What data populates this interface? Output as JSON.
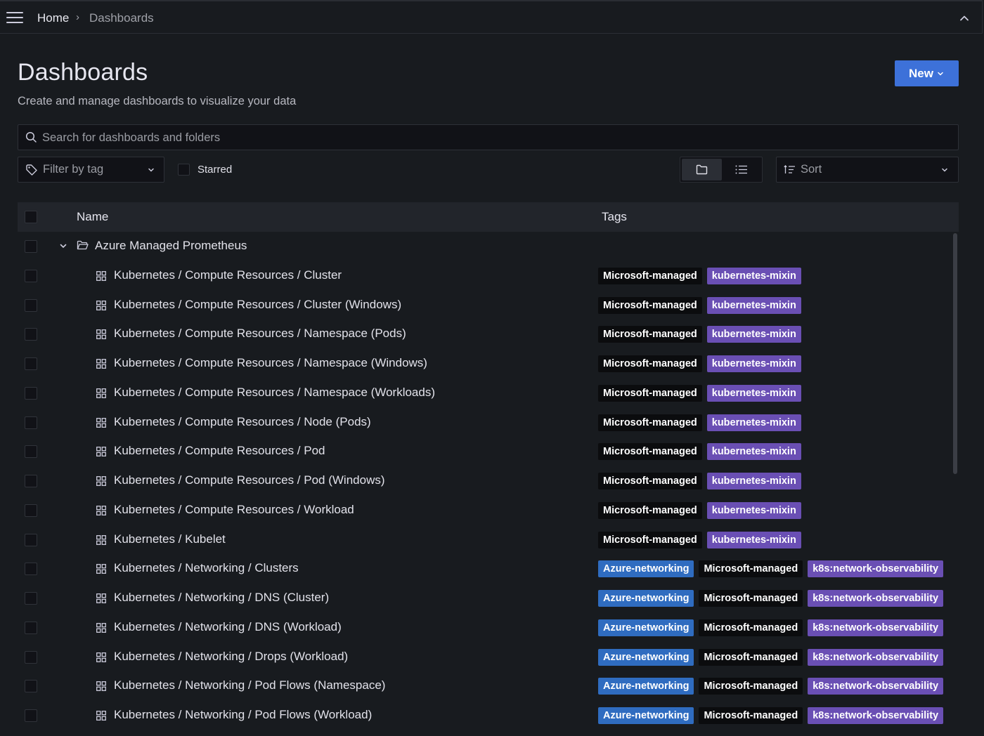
{
  "breadcrumb": {
    "home": "Home",
    "separator": "›",
    "current": "Dashboards"
  },
  "page": {
    "title": "Dashboards",
    "subtitle": "Create and manage dashboards to visualize your data",
    "new_button": "New"
  },
  "search": {
    "placeholder": "Search for dashboards and folders"
  },
  "filters": {
    "tag_placeholder": "Filter by tag",
    "starred_label": "Starred",
    "sort_placeholder": "Sort"
  },
  "table": {
    "headers": {
      "name": "Name",
      "tags": "Tags"
    }
  },
  "colors": {
    "microsoft_managed": "#0b0c0e",
    "kubernetes_mixin": "#6a4fb4",
    "azure_networking": "#2f6cc0",
    "k8s_observability": "#6a4fb4"
  },
  "folder": {
    "name": "Azure Managed Prometheus"
  },
  "dashboards": [
    {
      "name": "Kubernetes / Compute Resources / Cluster",
      "tags": [
        "Microsoft-managed",
        "kubernetes-mixin"
      ]
    },
    {
      "name": "Kubernetes / Compute Resources / Cluster (Windows)",
      "tags": [
        "Microsoft-managed",
        "kubernetes-mixin"
      ]
    },
    {
      "name": "Kubernetes / Compute Resources / Namespace (Pods)",
      "tags": [
        "Microsoft-managed",
        "kubernetes-mixin"
      ]
    },
    {
      "name": "Kubernetes / Compute Resources / Namespace (Windows)",
      "tags": [
        "Microsoft-managed",
        "kubernetes-mixin"
      ]
    },
    {
      "name": "Kubernetes / Compute Resources / Namespace (Workloads)",
      "tags": [
        "Microsoft-managed",
        "kubernetes-mixin"
      ]
    },
    {
      "name": "Kubernetes / Compute Resources / Node (Pods)",
      "tags": [
        "Microsoft-managed",
        "kubernetes-mixin"
      ]
    },
    {
      "name": "Kubernetes / Compute Resources / Pod",
      "tags": [
        "Microsoft-managed",
        "kubernetes-mixin"
      ]
    },
    {
      "name": "Kubernetes / Compute Resources / Pod (Windows)",
      "tags": [
        "Microsoft-managed",
        "kubernetes-mixin"
      ]
    },
    {
      "name": "Kubernetes / Compute Resources / Workload",
      "tags": [
        "Microsoft-managed",
        "kubernetes-mixin"
      ]
    },
    {
      "name": "Kubernetes / Kubelet",
      "tags": [
        "Microsoft-managed",
        "kubernetes-mixin"
      ]
    },
    {
      "name": "Kubernetes / Networking / Clusters",
      "tags": [
        "Azure-networking",
        "Microsoft-managed",
        "k8s:network-observability"
      ]
    },
    {
      "name": "Kubernetes / Networking / DNS (Cluster)",
      "tags": [
        "Azure-networking",
        "Microsoft-managed",
        "k8s:network-observability"
      ]
    },
    {
      "name": "Kubernetes / Networking / DNS (Workload)",
      "tags": [
        "Azure-networking",
        "Microsoft-managed",
        "k8s:network-observability"
      ]
    },
    {
      "name": "Kubernetes / Networking / Drops (Workload)",
      "tags": [
        "Azure-networking",
        "Microsoft-managed",
        "k8s:network-observability"
      ]
    },
    {
      "name": "Kubernetes / Networking / Pod Flows (Namespace)",
      "tags": [
        "Azure-networking",
        "Microsoft-managed",
        "k8s:network-observability"
      ]
    },
    {
      "name": "Kubernetes / Networking / Pod Flows (Workload)",
      "tags": [
        "Azure-networking",
        "Microsoft-managed",
        "k8s:network-observability"
      ]
    }
  ]
}
